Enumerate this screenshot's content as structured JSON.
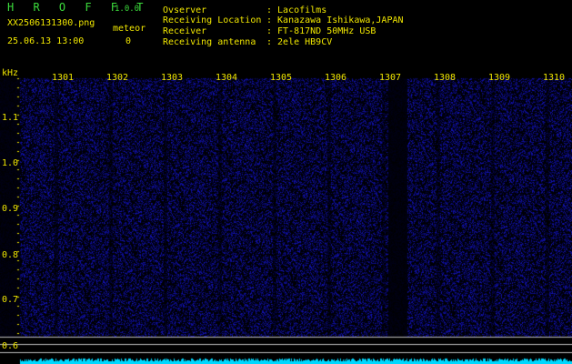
{
  "app": {
    "brand": "H R O F F T",
    "version": "1.0.0"
  },
  "file": {
    "name": "XX2506131300.png",
    "datetime": "25.06.13 13:00"
  },
  "counter": {
    "label": "meteor",
    "value": "0"
  },
  "info": [
    {
      "key": "Ovserver",
      "value": ": Lacofilms"
    },
    {
      "key": "Receiving Location",
      "value": ": Kanazawa Ishikawa,JAPAN"
    },
    {
      "key": "Receiver",
      "value": ": FT-817ND 50MHz USB"
    },
    {
      "key": "Receiving antenna",
      "value": ": 2ele HB9CV"
    }
  ],
  "axis": {
    "unit": "kHz",
    "y_ticks": [
      "1.1",
      "1.0",
      "0.9",
      "0.8",
      "0.7",
      "0.6"
    ],
    "x_ticks": [
      "1301",
      "1302",
      "1303",
      "1304",
      "1305",
      "1306",
      "1307",
      "1308",
      "1309",
      "1310"
    ]
  },
  "colors": {
    "label": "#f0e600",
    "title": "#3cdc3c",
    "noise": "#1a1a8c",
    "signal": "#00d8ff"
  }
}
